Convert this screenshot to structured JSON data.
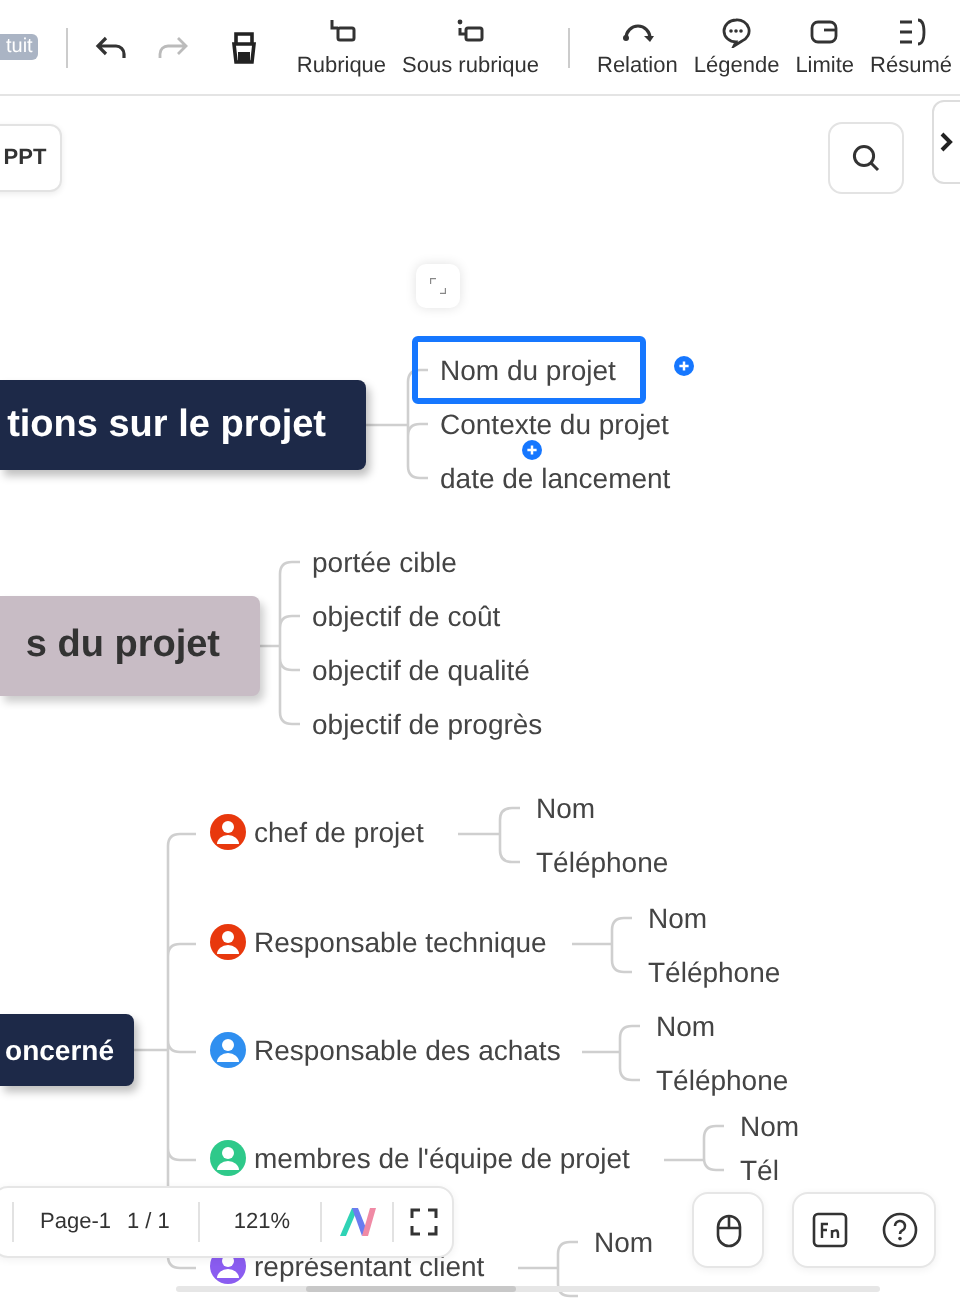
{
  "toolbar": {
    "badge": "tuit",
    "undo": {
      "disabled": false
    },
    "redo": {
      "disabled": true
    },
    "tools": [
      {
        "label": "Rubrique"
      },
      {
        "label": "Sous rubrique"
      },
      {
        "label": "Relation"
      },
      {
        "label": "Légende"
      },
      {
        "label": "Limite"
      },
      {
        "label": "Résumé"
      }
    ]
  },
  "ppt_button": "PPT",
  "topics": [
    {
      "kind": "dark",
      "label": "tions sur le projet",
      "children": [
        {
          "label": "Nom du projet",
          "selected": true
        },
        {
          "label": "Contexte du projet",
          "selected": false
        },
        {
          "label": "date de lancement",
          "selected": false
        }
      ]
    },
    {
      "kind": "mauve",
      "label": "s du projet",
      "children": [
        {
          "label": "portée cible",
          "selected": false
        },
        {
          "label": "objectif de coût",
          "selected": false
        },
        {
          "label": "objectif de qualité",
          "selected": false
        },
        {
          "label": "objectif de progrès",
          "selected": false
        }
      ]
    },
    {
      "kind": "dark",
      "label": "oncerné",
      "roles": [
        {
          "label": "chef de projet",
          "color": "#e8380d",
          "children": [
            "Nom",
            "Téléphone"
          ]
        },
        {
          "label": "Responsable technique",
          "color": "#e8380d",
          "children": [
            "Nom",
            "Téléphone"
          ]
        },
        {
          "label": "Responsable des achats",
          "color": "#2f8ff0",
          "children": [
            "Nom",
            "Téléphone"
          ]
        },
        {
          "label": "membres de l'équipe de projet",
          "color": "#2ec98a",
          "children": [
            "Nom",
            "Tél"
          ]
        },
        {
          "label": "représentant client",
          "color": "#8a5cf0",
          "children": [
            "Nom"
          ]
        }
      ]
    }
  ],
  "status": {
    "page": "Page-1",
    "count": "1 / 1",
    "zoom": "121%"
  }
}
